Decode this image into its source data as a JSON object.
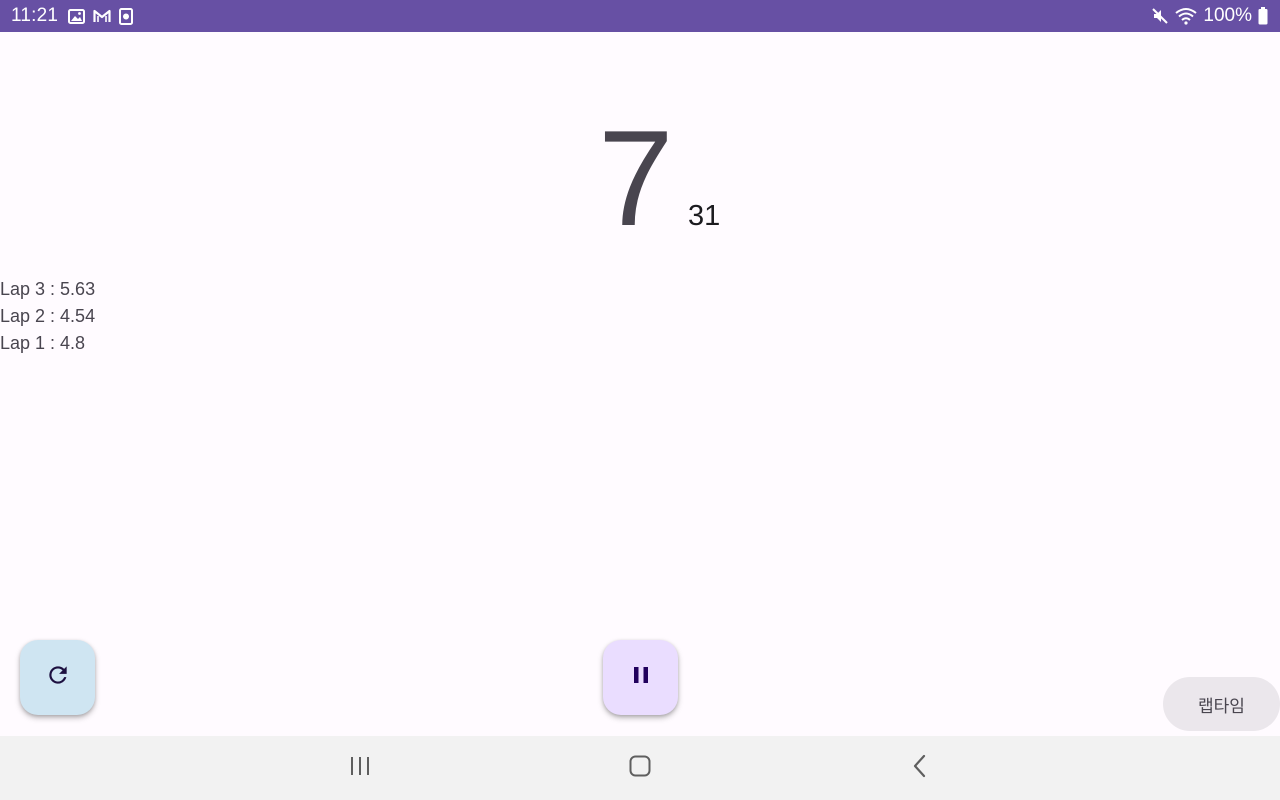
{
  "status_bar": {
    "time": "11:21",
    "battery_text": "100%",
    "background_color": "#6750a4",
    "left_icons": [
      "gallery-icon",
      "gmail-icon",
      "media-icon"
    ],
    "right_icons": [
      "mute-icon",
      "wifi-icon",
      "battery-icon"
    ]
  },
  "timer": {
    "seconds": "7",
    "centiseconds": "31"
  },
  "laps": [
    {
      "text": "Lap 3 : 5.63"
    },
    {
      "text": "Lap 2 : 4.54"
    },
    {
      "text": "Lap 1 : 4.8"
    }
  ],
  "controls": {
    "reset_icon": "refresh-icon",
    "pause_icon": "pause-icon",
    "lap_button_label": "랩타임",
    "reset_color": "#cfe5f2",
    "pause_color": "#eaddff"
  },
  "nav_bar": {
    "icons": [
      "recents-icon",
      "home-icon",
      "back-icon"
    ]
  }
}
